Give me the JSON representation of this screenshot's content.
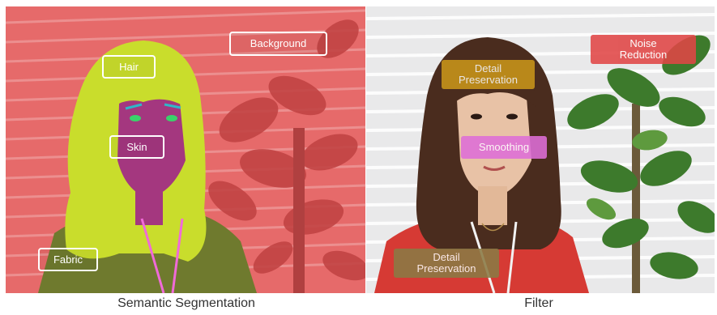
{
  "segmentation": {
    "caption": "Semantic Segmentation",
    "labels": {
      "hair": "Hair",
      "skin": "Skin",
      "background": "Background",
      "fabric": "Fabric"
    },
    "colors": {
      "background": "#e86a6a",
      "hair": "#c9dd2c",
      "skin": "#a4377f",
      "fabric": "#6f7a2e",
      "eyes": "#3ad16a",
      "brows": "#2fb7c9",
      "lanyard": "#f06ad8"
    }
  },
  "filter": {
    "caption": "Filter",
    "labels": {
      "detail_top": "Detail\nPreservation",
      "noise": "Noise\nReduction",
      "smoothing": "Smoothing",
      "detail_bottom": "Detail\nPreservation"
    },
    "colors": {
      "detail_top": "#c9951a",
      "noise": "#e04646",
      "smoothing": "#de6ed8",
      "detail_bottom": "#8a7a44"
    }
  }
}
